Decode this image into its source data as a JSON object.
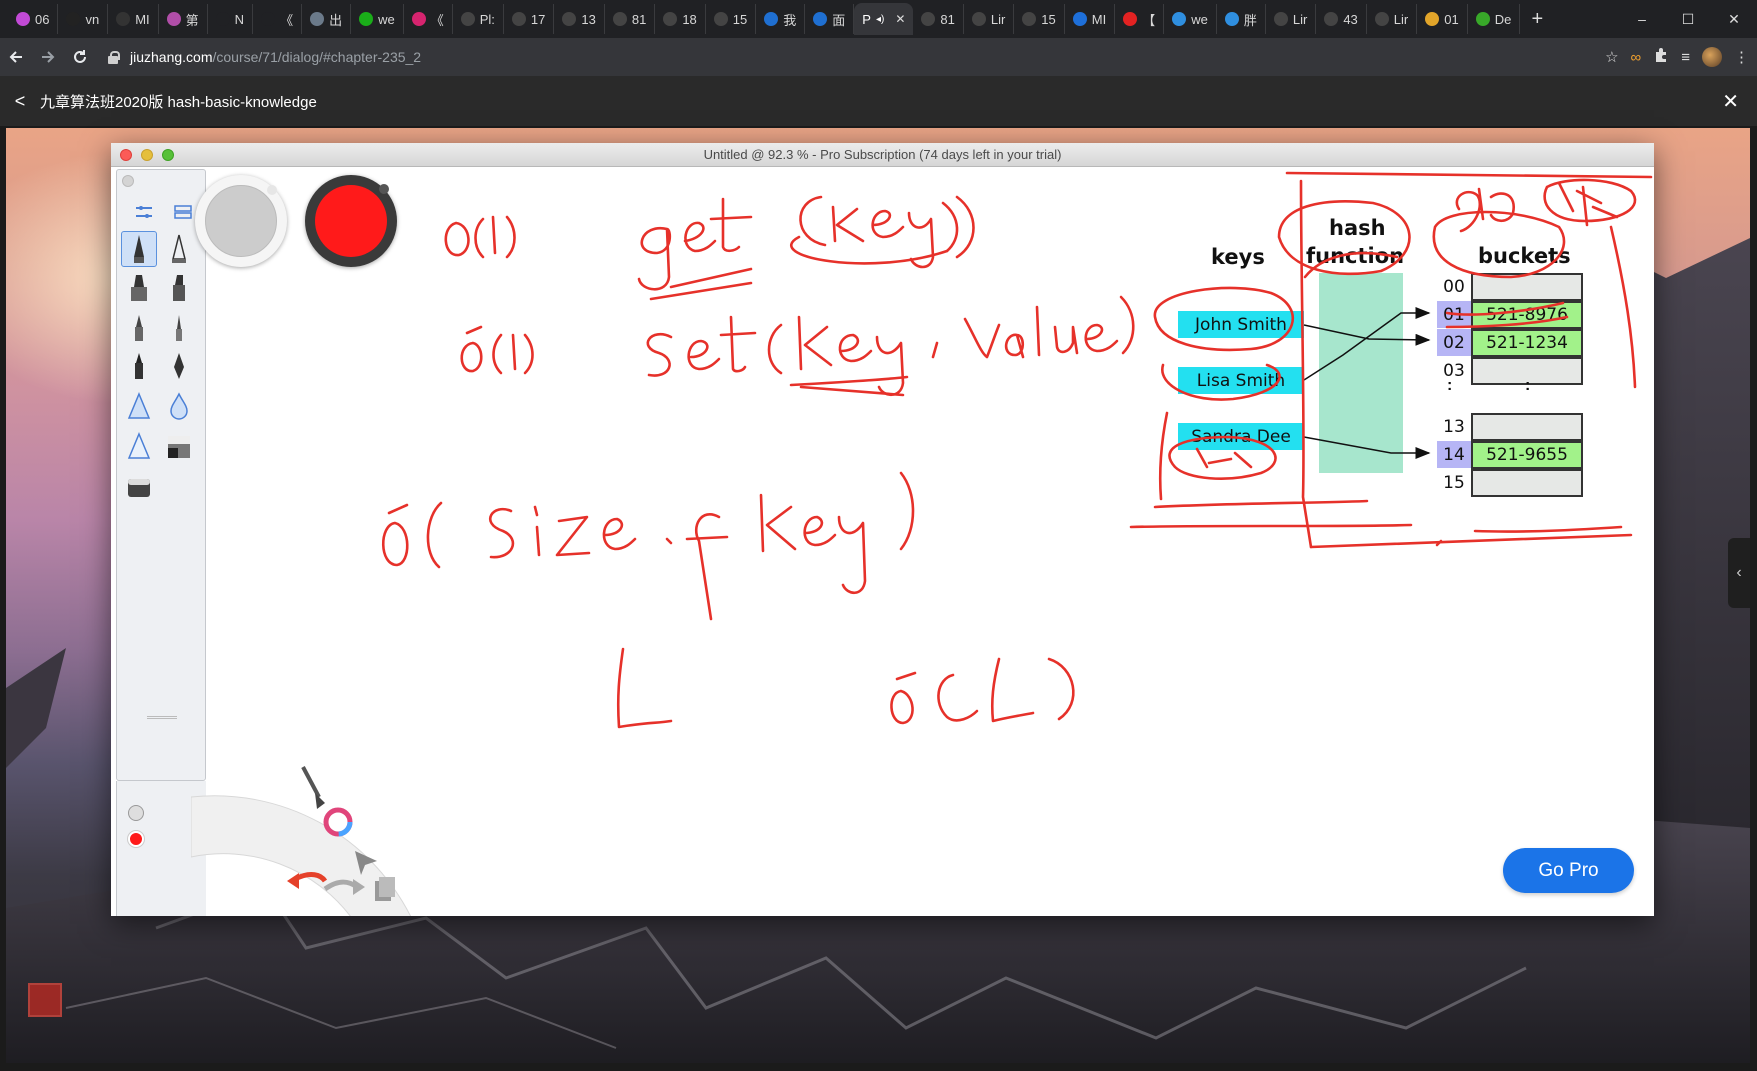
{
  "browser": {
    "tabs": [
      {
        "label": "06",
        "fav": "#c24ad6"
      },
      {
        "label": "vn",
        "fav": "#222222"
      },
      {
        "label": "MI",
        "fav": "#333333"
      },
      {
        "label": "第",
        "fav": "#b04ea8"
      },
      {
        "label": "N",
        "fav": "#202124"
      },
      {
        "label": "《",
        "fav": "#202124"
      },
      {
        "label": "出",
        "fav": "#6b7a8a"
      },
      {
        "label": "we",
        "fav": "#1aad19"
      },
      {
        "label": "《",
        "fav": "#d6246f"
      },
      {
        "label": "Pl:",
        "fav": "#444444"
      },
      {
        "label": "17",
        "fav": "#444444"
      },
      {
        "label": "13",
        "fav": "#444444"
      },
      {
        "label": "81",
        "fav": "#444444"
      },
      {
        "label": "18",
        "fav": "#444444"
      },
      {
        "label": "15",
        "fav": "#444444"
      },
      {
        "label": "我",
        "fav": "#1f6fd1"
      },
      {
        "label": "面",
        "fav": "#1f6fd1"
      }
    ],
    "active_tab": {
      "label": "P"
    },
    "tabs_right": [
      {
        "label": "81",
        "fav": "#444444"
      },
      {
        "label": "Lir",
        "fav": "#444444"
      },
      {
        "label": "15",
        "fav": "#444444"
      },
      {
        "label": "MI",
        "fav": "#1e6fd9"
      },
      {
        "label": "【",
        "fav": "#e32222"
      },
      {
        "label": "we",
        "fav": "#2f8fe0"
      },
      {
        "label": "胖",
        "fav": "#2f8fe0"
      },
      {
        "label": "Lir",
        "fav": "#444444"
      },
      {
        "label": "43",
        "fav": "#444444"
      },
      {
        "label": "Lir",
        "fav": "#444444"
      },
      {
        "label": "01",
        "fav": "#e2a52a"
      },
      {
        "label": "De",
        "fav": "#38a829"
      }
    ],
    "new_tab": "+",
    "window_controls": [
      "–",
      "☐",
      "✕"
    ],
    "url_host": "jiuzhang.com",
    "url_path": "/course/71/dialog/#chapter-235_2"
  },
  "course": {
    "title": "九章算法班2020版 hash-basic-knowledge",
    "back": "<",
    "close": "✕"
  },
  "app": {
    "window_title": "Untitled @ 92.3 % - Pro Subscription (74 days left in your trial)",
    "go_pro": "Go Pro",
    "primary_color": "#ff1a1a",
    "secondary_color": "#cccccc"
  },
  "diagram": {
    "keys_header": "keys",
    "hash_header_1": "hash",
    "hash_header_2": "function",
    "buckets_header": "buckets",
    "keys": [
      "John Smith",
      "Lisa Smith",
      "Sandra Dee"
    ],
    "bucket_rows_top": [
      {
        "idx": "00",
        "value": "",
        "hl": false
      },
      {
        "idx": "01",
        "value": "521-8976",
        "hl": true
      },
      {
        "idx": "02",
        "value": "521-1234",
        "hl": true
      },
      {
        "idx": "03",
        "value": "",
        "hl": false
      }
    ],
    "ellipsis": ":",
    "bucket_rows_bottom": [
      {
        "idx": "13",
        "value": "",
        "hl": false
      },
      {
        "idx": "14",
        "value": "521-9655",
        "hl": true
      },
      {
        "idx": "15",
        "value": "",
        "hl": false
      }
    ]
  }
}
